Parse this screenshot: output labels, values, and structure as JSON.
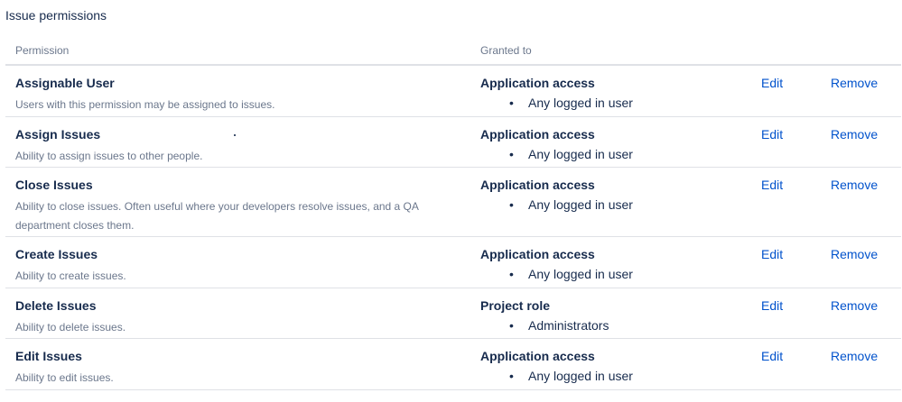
{
  "section_title": "Issue permissions",
  "table": {
    "headers": {
      "permission": "Permission",
      "granted_to": "Granted to"
    },
    "actions": {
      "edit": "Edit",
      "remove": "Remove"
    },
    "rows": [
      {
        "name": "Assignable User",
        "description": "Users with this permission may be assigned to issues.",
        "granted_type": "Application access",
        "granted_items": [
          "Any logged in user"
        ]
      },
      {
        "name": "Assign Issues",
        "description": "Ability to assign issues to other people.",
        "granted_type": "Application access",
        "granted_items": [
          "Any logged in user"
        ]
      },
      {
        "name": "Close Issues",
        "description": "Ability to close issues. Often useful where your developers resolve issues, and a QA department closes them.",
        "granted_type": "Application access",
        "granted_items": [
          "Any logged in user"
        ]
      },
      {
        "name": "Create Issues",
        "description": "Ability to create issues.",
        "granted_type": "Application access",
        "granted_items": [
          "Any logged in user"
        ]
      },
      {
        "name": "Delete Issues",
        "description": "Ability to delete issues.",
        "granted_type": "Project role",
        "granted_items": [
          "Administrators"
        ]
      },
      {
        "name": "Edit Issues",
        "description": "Ability to edit issues.",
        "granted_type": "Application access",
        "granted_items": [
          "Any logged in user"
        ]
      }
    ]
  }
}
